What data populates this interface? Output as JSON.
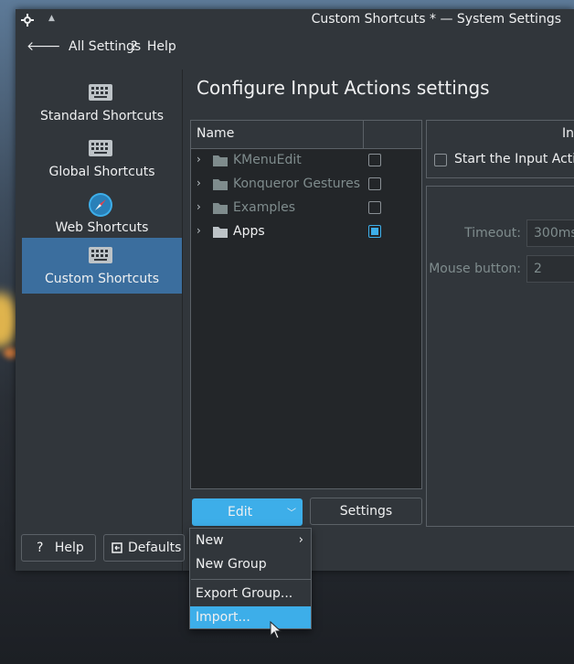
{
  "window": {
    "title": "Custom Shortcuts * — System Settings"
  },
  "toolbar": {
    "back_label": "All Settings",
    "help_label": "Help"
  },
  "sidebar": {
    "items": [
      {
        "label": "Standard Shortcuts",
        "active": false
      },
      {
        "label": "Global Shortcuts",
        "active": false
      },
      {
        "label": "Web Shortcuts",
        "active": false
      },
      {
        "label": "Custom Shortcuts",
        "active": true
      }
    ]
  },
  "page": {
    "title": "Configure Input Actions settings"
  },
  "tree": {
    "header": {
      "name": "Name"
    },
    "rows": [
      {
        "label": "KMenuEdit",
        "enabled": false,
        "checked": false
      },
      {
        "label": "Konqueror Gestures",
        "enabled": false,
        "checked": false
      },
      {
        "label": "Examples",
        "enabled": false,
        "checked": false
      },
      {
        "label": "Apps",
        "enabled": true,
        "checked": true
      }
    ]
  },
  "buttons": {
    "edit": "Edit",
    "settings": "Settings",
    "help": "Help",
    "defaults": "Defaults"
  },
  "right_panel": {
    "title": "In",
    "start_checkbox_label": "Start the Input Actio",
    "timeout_label": "Timeout:",
    "timeout_value": "300ms",
    "mouse_button_label": "Mouse button:",
    "mouse_button_value": "2"
  },
  "edit_menu": {
    "items": [
      {
        "label": "New",
        "submenu": true
      },
      {
        "label": "New Group"
      },
      {
        "label": "Export Group..."
      },
      {
        "label": "Import..."
      }
    ]
  },
  "colors": {
    "accent": "#3daee9",
    "selection": "#3b6e9e",
    "window_bg": "#31363b",
    "view_bg": "#232629"
  }
}
